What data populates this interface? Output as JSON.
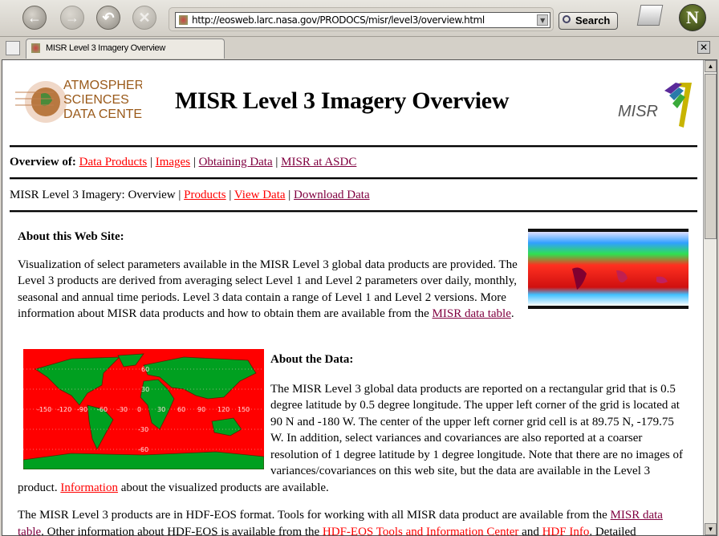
{
  "browser": {
    "url": "http://eosweb.larc.nasa.gov/PRODOCS/misr/level3/overview.html",
    "search_label": "Search",
    "tab_title": "MISR Level 3 Imagery Overview",
    "logo_letter": "N"
  },
  "header": {
    "asdc_logo": [
      "ATMOSPHERIC",
      "SCIENCES",
      "DATA CENTER"
    ],
    "title": "MISR Level 3 Imagery Overview",
    "misr_logo": "MISR"
  },
  "nav1": {
    "label": "Overview of:",
    "links": [
      "Data Products",
      "Images",
      "Obtaining Data",
      "MISR at ASDC"
    ]
  },
  "nav2": {
    "label": "MISR Level 3 Imagery:",
    "current": "Overview",
    "links": [
      "Products",
      "View Data",
      "Download Data"
    ]
  },
  "about_site": {
    "heading": "About this Web Site:",
    "text": "Visualization of select parameters available in the MISR Level 3 global data products are provided. The Level 3 products are derived from averaging select Level 1 and Level 2 parameters over daily, monthly, seasonal and annual time periods. Level 3 data contain a range of Level 1 and Level 2 versions. More information about MISR data products and how to obtain them are available from the ",
    "link": "MISR data table",
    "end": "."
  },
  "about_data": {
    "heading": "About the Data:",
    "text": "The MISR Level 3 global data products are reported on a rectangular grid that is 0.5 degree latitude by 0.5 degree longitude. The upper left corner of the grid is located at 90 N and -180 W. The center of the upper left corner grid cell is at 89.75 N, -179.75 W. In addition, select variances and covariances are also reported at a coarser resolution of 1 degree latitude by 1 degree longitude. Note that there are no images of variances/covariances on this web site, but the data are available in the Level 3 product. ",
    "link": "Information",
    "end": " about the visualized products are available."
  },
  "map": {
    "lon_labels": [
      "-150",
      "-120",
      "-90",
      "-60",
      "-30",
      "0",
      "30",
      "60",
      "90",
      "120",
      "150"
    ],
    "lat_labels": [
      "60",
      "30",
      "-30",
      "-60"
    ]
  },
  "hdf": {
    "t1": "The MISR Level 3 products are in HDF-EOS format. Tools for working with all MISR data product are available from the ",
    "l1": "MISR data table",
    "t2": ". Other information about HDF-EOS is available from the ",
    "l2": "HDF-EOS Tools and Information Center",
    "t3": " and ",
    "l3": "HDF Info",
    "t4": ". Detailed"
  },
  "colors": {
    "link": "#ff0000",
    "visited": "#800040",
    "ocean": "#ff0000",
    "land": "#00a020"
  }
}
